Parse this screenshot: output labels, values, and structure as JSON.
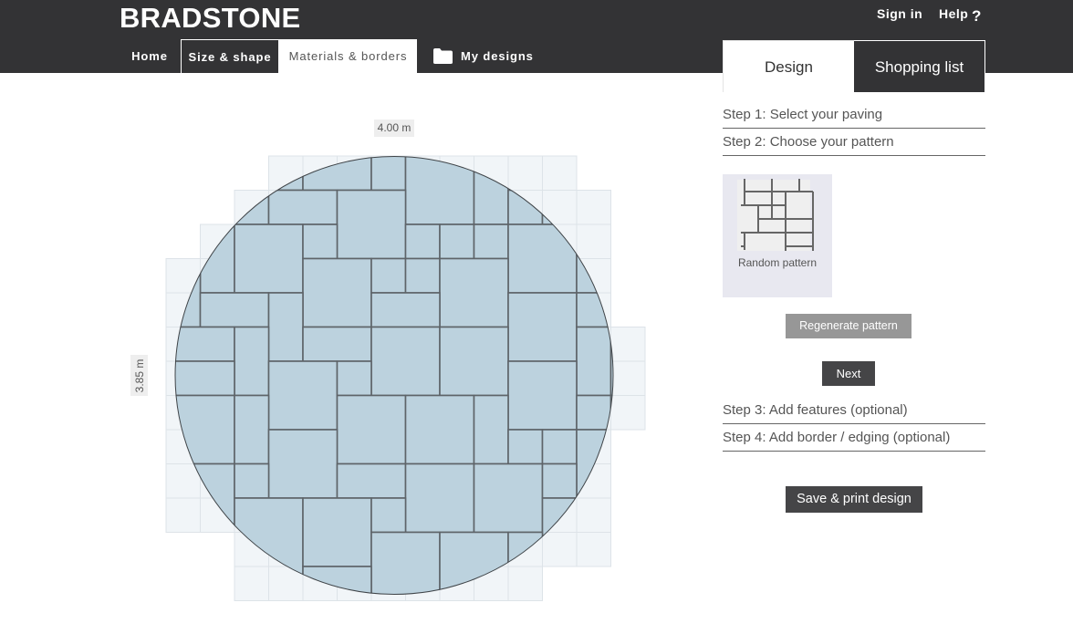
{
  "brand": {
    "logo": "BRADSTONE"
  },
  "header": {
    "sign_in": "Sign in",
    "help": "Help",
    "help_icon_glyph": "?"
  },
  "nav": {
    "tabs": [
      {
        "label": "Home"
      },
      {
        "label": "Size & shape"
      },
      {
        "label": "Materials & borders",
        "active": true
      },
      {
        "label": "My designs",
        "icon": "folder-icon"
      }
    ]
  },
  "canvas": {
    "shape": "circle",
    "width_label": "4.00 m",
    "height_label": "3.85 m",
    "pattern": "Random pattern"
  },
  "panel": {
    "tabs": [
      {
        "label": "Design",
        "active": true
      },
      {
        "label": "Shopping list"
      }
    ],
    "steps": [
      {
        "label": "Step 1: Select your paving"
      },
      {
        "label": "Step 2: Choose your pattern"
      },
      {
        "label": "Step 3: Add features (optional)"
      },
      {
        "label": "Step 4: Add border / edging (optional)"
      }
    ],
    "pattern_option": {
      "label": "Random pattern",
      "selected": true
    },
    "regenerate_label": "Regenerate pattern",
    "next_label": "Next",
    "save_label": "Save & print design"
  },
  "colors": {
    "header_bg": "#333335",
    "slab_fill": "#bcd2de",
    "slab_joint": "#5e6469",
    "grid_cell": "#f1f5f8",
    "grid_line": "#dde3e8",
    "button_dark": "#454547",
    "button_grey": "#979797"
  }
}
